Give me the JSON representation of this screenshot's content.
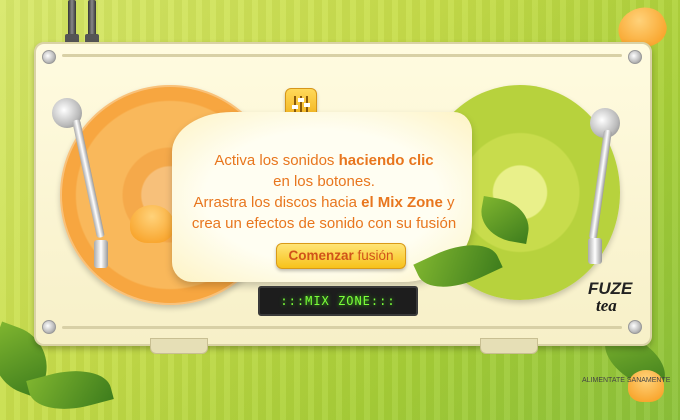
{
  "message": {
    "line1_pre": "Activa los sonidos ",
    "line1_bold": "haciendo clic",
    "line2": "en los botones.",
    "line3_pre": "Arrastra los discos hacia ",
    "line3_bold": "el Mix Zone",
    "line3_post": " y",
    "line4": "crea un efectos de sonido con su fusión"
  },
  "start_button": {
    "bold": "Comenzar",
    "light": " fusión"
  },
  "lcd_display": ":::MIX ZONE:::",
  "brand": {
    "line1": "FUZE",
    "line2": "tea"
  },
  "slogan": "ALIMENTATE SANAMENTE",
  "colors": {
    "accent_orange": "#e8761e",
    "lcd_green": "#7cff3a"
  },
  "icons": {
    "mixer_button": "equalizer-sliders-icon"
  }
}
